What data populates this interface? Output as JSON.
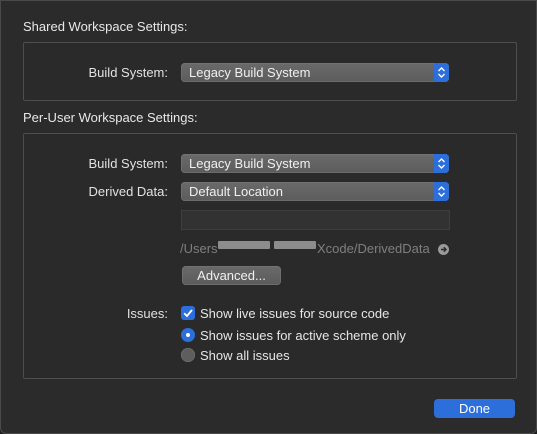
{
  "shared": {
    "title": "Shared Workspace Settings:",
    "build_system_label": "Build System:",
    "build_system_value": "Legacy Build System"
  },
  "per_user": {
    "title": "Per-User Workspace Settings:",
    "build_system_label": "Build System:",
    "build_system_value": "Legacy Build System",
    "derived_data_label": "Derived Data:",
    "derived_data_value": "Default Location",
    "custom_path_value": "",
    "path_prefix": "/Users",
    "path_suffix": "Xcode/DerivedData",
    "advanced_label": "Advanced...",
    "issues_label": "Issues:",
    "live_issues_label": "Show live issues for source code",
    "live_issues_checked": true,
    "active_scheme_label": "Show issues for active scheme only",
    "all_issues_label": "Show all issues",
    "selected_issue_option": "active_scheme"
  },
  "footer": {
    "done_label": "Done"
  },
  "colors": {
    "accent": "#2c6fdb",
    "background": "#2b2b2b"
  }
}
